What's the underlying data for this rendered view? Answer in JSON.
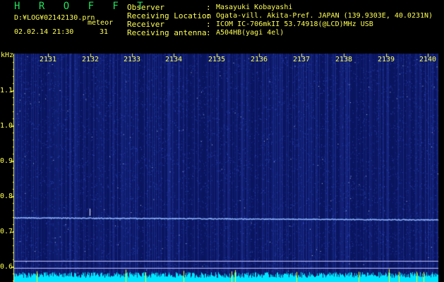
{
  "header": {
    "program": "H R O F F T",
    "log_path": "D:¥LOG¥02142130.prn",
    "mode": "meteor",
    "datetime": "02.02.14 21:30",
    "count": "31"
  },
  "station": {
    "observer_label": "Observer",
    "observer": "Masayuki Kobayashi",
    "location_label": "Receiving Location",
    "location": "Ogata-vill. Akita-Pref. JAPAN (139.9303E, 40.0231N)",
    "receiver_label": "Receiver",
    "receiver": "ICOM IC-706mkII 53.74918(@LCD)MHz USB",
    "antenna_label": "Receiving antenna",
    "antenna": "A504HB(yagi 4el)",
    "colon": ":"
  },
  "axis": {
    "unit": "kHz",
    "time_ticks": [
      "2131",
      "2132",
      "2133",
      "2134",
      "2135",
      "2136",
      "2137",
      "2138",
      "2139",
      "2140"
    ],
    "freq_ticks": [
      "1.1",
      "1.0",
      "0.9",
      "0.8",
      "0.7",
      "0.6"
    ]
  },
  "colors": {
    "background": "#000000",
    "text": "#ffff55",
    "title": "#22e05a",
    "waterfall": "#0a1560",
    "carrier": "#8fb8ff",
    "marker_line": "#c8c8ff",
    "spectrum": "#00e5ff",
    "peak": "#ffff00"
  }
}
